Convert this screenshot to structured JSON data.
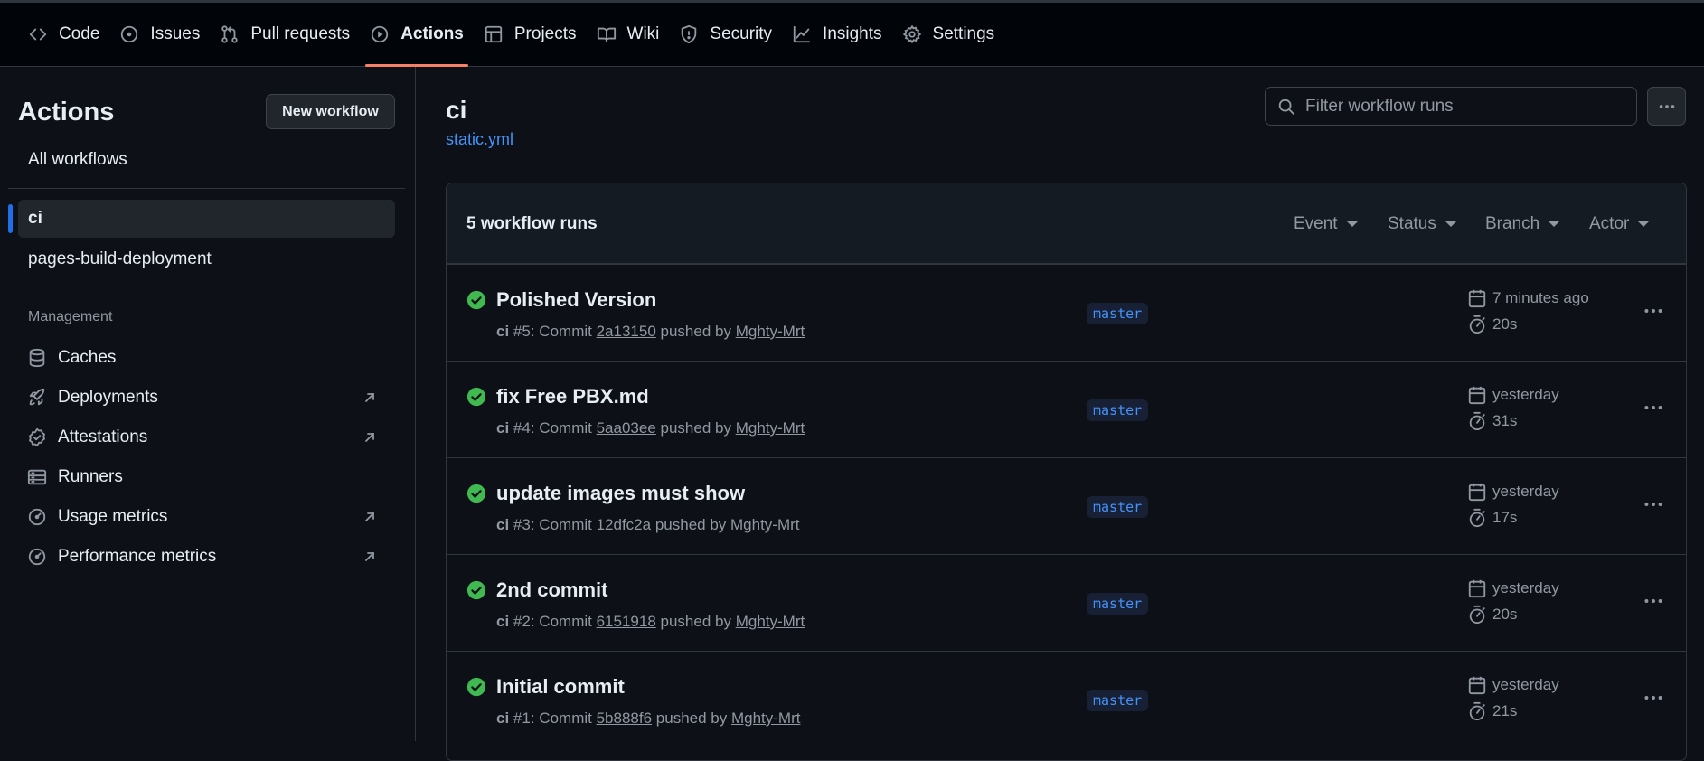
{
  "nav": {
    "tabs": [
      {
        "label": "Code",
        "icon": "code-icon"
      },
      {
        "label": "Issues",
        "icon": "issue-icon"
      },
      {
        "label": "Pull requests",
        "icon": "pull-request-icon"
      },
      {
        "label": "Actions",
        "icon": "play-icon",
        "active": true
      },
      {
        "label": "Projects",
        "icon": "table-icon"
      },
      {
        "label": "Wiki",
        "icon": "book-icon"
      },
      {
        "label": "Security",
        "icon": "shield-icon"
      },
      {
        "label": "Insights",
        "icon": "graph-icon"
      },
      {
        "label": "Settings",
        "icon": "gear-icon"
      }
    ]
  },
  "sidebar": {
    "title": "Actions",
    "new_workflow_label": "New workflow",
    "all_workflows": "All workflows",
    "workflows": [
      {
        "label": "ci",
        "selected": true
      },
      {
        "label": "pages-build-deployment"
      }
    ],
    "management_heading": "Management",
    "management": [
      {
        "label": "Caches",
        "icon": "database-icon",
        "external": false
      },
      {
        "label": "Deployments",
        "icon": "rocket-icon",
        "external": true
      },
      {
        "label": "Attestations",
        "icon": "verified-icon",
        "external": true
      },
      {
        "label": "Runners",
        "icon": "server-icon",
        "external": false
      },
      {
        "label": "Usage metrics",
        "icon": "meter-icon",
        "external": true
      },
      {
        "label": "Performance metrics",
        "icon": "meter-icon",
        "external": true
      }
    ]
  },
  "main": {
    "workflow_title": "ci",
    "workflow_file": "static.yml",
    "filter_placeholder": "Filter workflow runs",
    "runs_count": "5 workflow runs",
    "filters": [
      "Event",
      "Status",
      "Branch",
      "Actor"
    ],
    "runs": [
      {
        "title": "Polished Version",
        "workflow": "ci",
        "number": "#5",
        "commit": "2a13150",
        "actor": "Mghty-Mrt",
        "branch": "master",
        "when": "7 minutes ago",
        "duration": "20s",
        "status": "success"
      },
      {
        "title": "fix Free PBX.md",
        "workflow": "ci",
        "number": "#4",
        "commit": "5aa03ee",
        "actor": "Mghty-Mrt",
        "branch": "master",
        "when": "yesterday",
        "duration": "31s",
        "status": "success"
      },
      {
        "title": "update images must show",
        "workflow": "ci",
        "number": "#3",
        "commit": "12dfc2a",
        "actor": "Mghty-Mrt",
        "branch": "master",
        "when": "yesterday",
        "duration": "17s",
        "status": "success"
      },
      {
        "title": "2nd commit",
        "workflow": "ci",
        "number": "#2",
        "commit": "6151918",
        "actor": "Mghty-Mrt",
        "branch": "master",
        "when": "yesterday",
        "duration": "20s",
        "status": "success"
      },
      {
        "title": "Initial commit",
        "workflow": "ci",
        "number": "#1",
        "commit": "5b888f6",
        "actor": "Mghty-Mrt",
        "branch": "master",
        "when": "yesterday",
        "duration": "21s",
        "status": "success"
      }
    ],
    "meta_commit_word": "Commit",
    "meta_pushed_word": "pushed by"
  },
  "colors": {
    "background": "#0d1117",
    "header": "#010409",
    "accent": "#f78166",
    "link": "#4493f8",
    "success": "#3fb950",
    "border": "#30363d"
  }
}
